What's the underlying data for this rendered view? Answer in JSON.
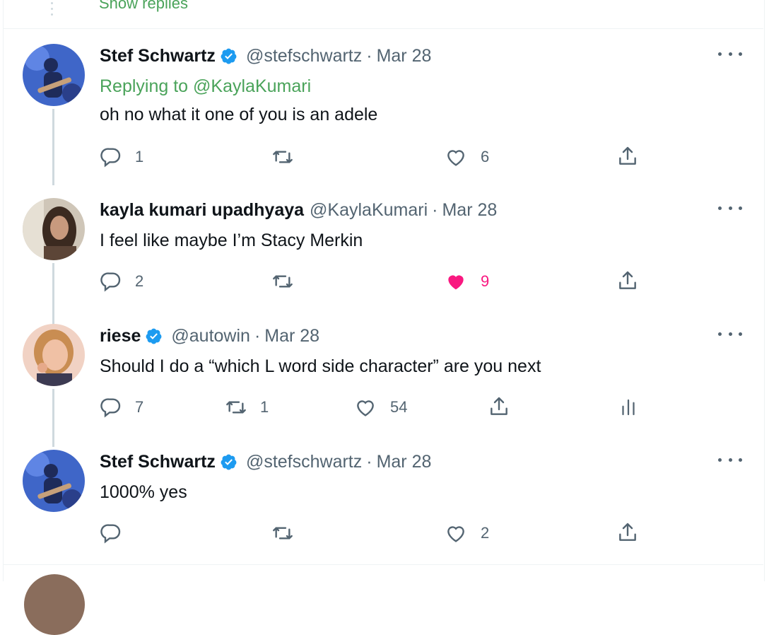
{
  "top": {
    "show_replies": "Show replies"
  },
  "tweets": [
    {
      "name": "Stef Schwartz",
      "verified": true,
      "handle": "@stefschwartz",
      "date": "Mar 28",
      "replying_prefix": "Replying to",
      "replying_handle": "@KaylaKumari",
      "text": "oh no what it one of you is an adele",
      "reply_count": "1",
      "retweet_count": "",
      "like_count": "6",
      "liked": false
    },
    {
      "name": "kayla kumari upadhyaya",
      "verified": false,
      "handle": "@KaylaKumari",
      "date": "Mar 28",
      "text": "I feel like maybe I’m Stacy Merkin",
      "reply_count": "2",
      "retweet_count": "",
      "like_count": "9",
      "liked": true
    },
    {
      "name": "riese",
      "verified": true,
      "handle": "@autowin",
      "date": "Mar 28",
      "text": "Should I do a “which L word side character” are you next",
      "reply_count": "7",
      "retweet_count": "1",
      "like_count": "54",
      "liked": false
    },
    {
      "name": "Stef Schwartz",
      "verified": true,
      "handle": "@stefschwartz",
      "date": "Mar 28",
      "text": "1000% yes",
      "reply_count": "",
      "retweet_count": "",
      "like_count": "2",
      "liked": false
    }
  ],
  "colors": {
    "accent": "#4aa35a",
    "verified": "#1d9bf0",
    "like": "#f91880",
    "muted": "#536471"
  },
  "icons": {
    "reply": "speech-bubble-icon",
    "retweet": "retweet-icon",
    "like": "heart-icon",
    "share": "share-icon",
    "analytics": "bar-chart-icon",
    "more": "more-dots-icon",
    "verified": "verified-badge-icon"
  }
}
